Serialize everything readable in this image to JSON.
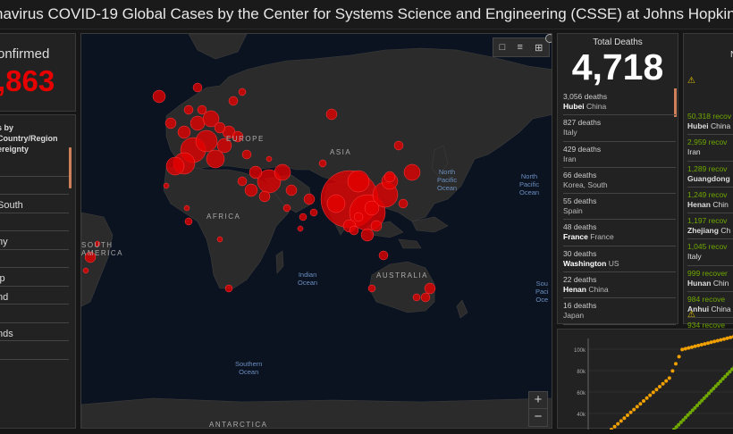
{
  "header": {
    "title": "navirus COVID-19 Global Cases by the Center for Systems Science and Engineering (CSSE) at Johns Hopkins University (J"
  },
  "confirmed": {
    "label": "onfirmed",
    "value": ",863"
  },
  "country_panel": {
    "title_line1": "s by Country/Region",
    "title_line2": "ereignty",
    "items": [
      "",
      "",
      "South",
      "",
      "ny",
      "",
      "ip",
      "nd",
      "",
      "nds",
      ""
    ]
  },
  "map": {
    "ocean_labels": {
      "north_pacific_1": "North\nPacific\nOcean",
      "north_pacific_2": "North\nPacific\nOcean",
      "indian": "Indian\nOcean",
      "southern": "Southern\nOcean",
      "south_pacific": "Sou\nPaci\nOce"
    },
    "land_labels": {
      "europe": "EUROPE",
      "africa": "AFRICA",
      "asia": "ASIA",
      "australia": "AUSTRALIA",
      "south_america": "SOUTH\nAMERICA",
      "antarctica": "ANTARCTICA"
    },
    "tools": [
      "bookmark-icon",
      "list-icon",
      "grid-icon"
    ],
    "zoom_in": "+",
    "zoom_out": "−",
    "marker_color": "#e60000"
  },
  "total_deaths": {
    "label": "Total Deaths",
    "value": "4,718",
    "items": [
      {
        "count": "3,056 deaths",
        "place": "Hubei",
        "country": "China"
      },
      {
        "count": "827 deaths",
        "place": "",
        "country": "Italy"
      },
      {
        "count": "429 deaths",
        "place": "",
        "country": "Iran"
      },
      {
        "count": "66 deaths",
        "place": "",
        "country": "Korea, South"
      },
      {
        "count": "55 deaths",
        "place": "",
        "country": "Spain"
      },
      {
        "count": "48 deaths",
        "place": "France",
        "country": "France"
      },
      {
        "count": "30 deaths",
        "place": "Washington",
        "country": "US"
      },
      {
        "count": "22 deaths",
        "place": "Henan",
        "country": "China"
      },
      {
        "count": "16 deaths",
        "place": "",
        "country": "Japan"
      }
    ]
  },
  "recovered": {
    "label": "N",
    "items": [
      {
        "count": "50,318 recov",
        "place": "Hubei",
        "country": "China"
      },
      {
        "count": "2,959 recov",
        "place": "",
        "country": "Iran"
      },
      {
        "count": "1,289 recov",
        "place": "Guangdong",
        "country": ""
      },
      {
        "count": "1,249 recov",
        "place": "Henan",
        "country": "Chin"
      },
      {
        "count": "1,197 recov",
        "place": "Zhejiang",
        "country": "Ch"
      },
      {
        "count": "1,045 recov",
        "place": "",
        "country": "Italy"
      },
      {
        "count": "999 recover",
        "place": "Hunan",
        "country": "Chin"
      },
      {
        "count": "984 recove",
        "place": "Anhui",
        "country": "China"
      },
      {
        "count": "934 recove",
        "place": "",
        "country": ""
      }
    ]
  },
  "chart": {
    "y_ticks": [
      "100k",
      "80k",
      "60k",
      "40k"
    ],
    "series_colors": {
      "china": "#f0a000",
      "recovered": "#70a800"
    }
  }
}
